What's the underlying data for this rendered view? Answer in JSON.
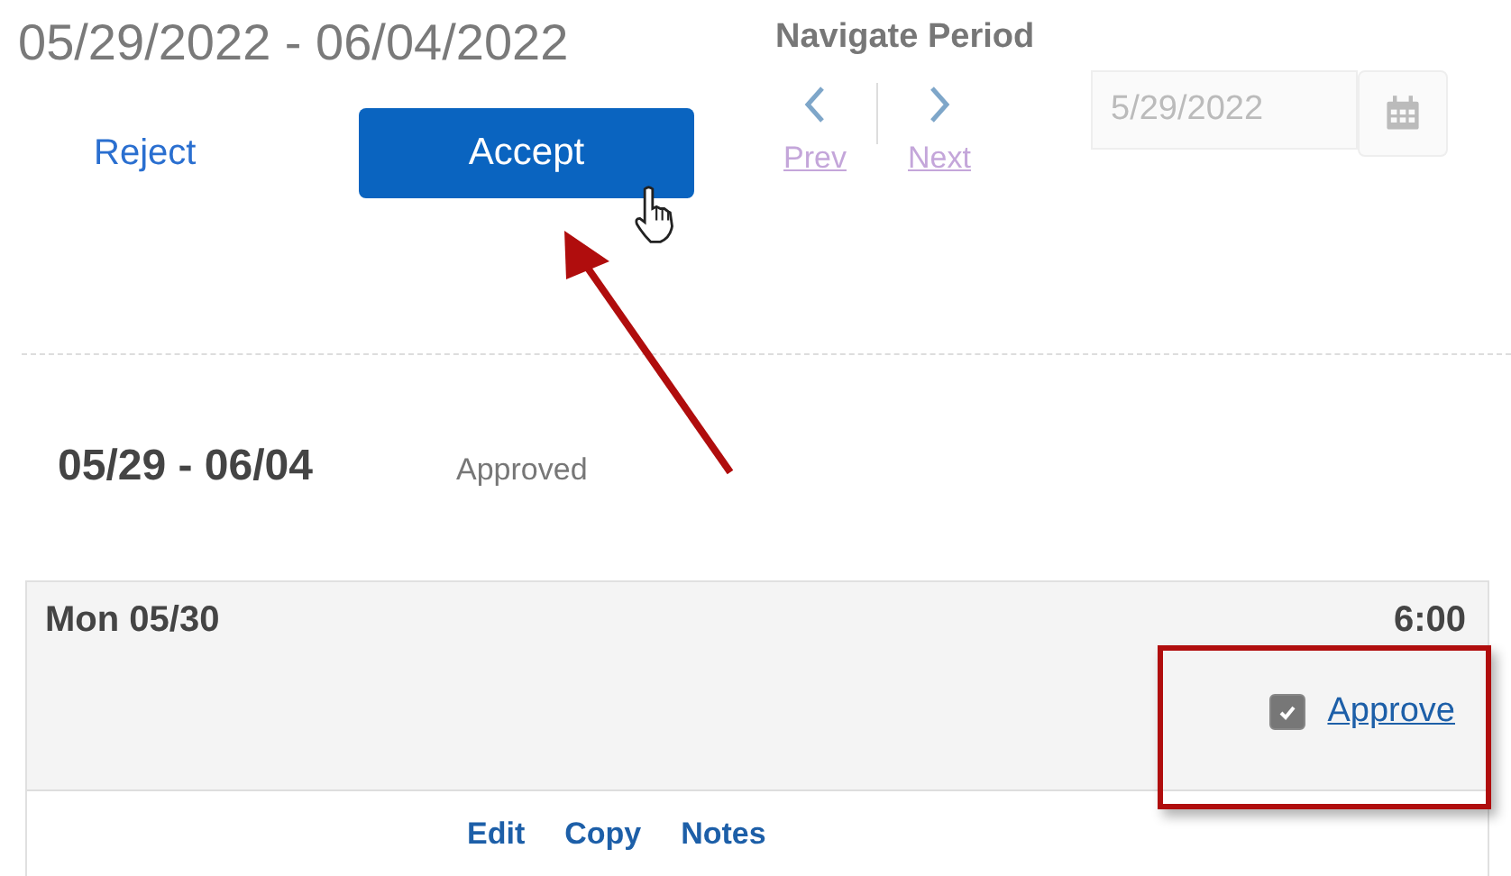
{
  "period": {
    "title": "05/29/2022 - 06/04/2022",
    "reject": "Reject",
    "accept": "Accept"
  },
  "navigate": {
    "label": "Navigate Period",
    "prev": "Prev",
    "next": "Next",
    "date_value": "5/29/2022"
  },
  "week": {
    "range": "05/29 - 06/04",
    "status": "Approved"
  },
  "day": {
    "label": "Mon 05/30",
    "hours": "6:00",
    "approve": {
      "label": "Approve",
      "checked": true
    },
    "actions": [
      "Edit",
      "Copy",
      "Notes"
    ]
  }
}
